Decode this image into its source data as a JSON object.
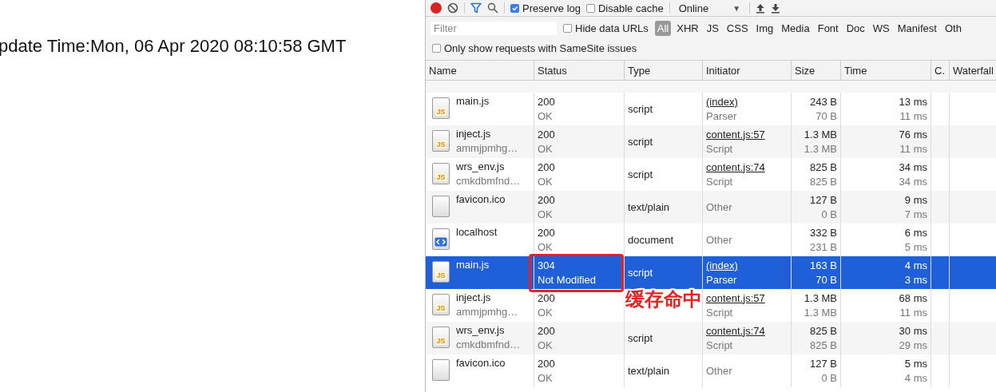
{
  "page": {
    "text": "pdate Time:Mon, 06 Apr 2020 08:10:58 GMT"
  },
  "devtools": {
    "toolbar": {
      "recording": true,
      "preserve_log": {
        "label": "Preserve log",
        "checked": true
      },
      "disable_cache": {
        "label": "Disable cache",
        "checked": false
      },
      "throttling": {
        "value": "Online",
        "caret": "▼"
      }
    },
    "filter": {
      "placeholder": "Filter",
      "hide_data_urls": {
        "label": "Hide data URLs",
        "checked": false
      },
      "types": [
        {
          "label": "All",
          "selected": true
        },
        {
          "label": "XHR",
          "selected": false
        },
        {
          "label": "JS",
          "selected": false
        },
        {
          "label": "CSS",
          "selected": false
        },
        {
          "label": "Img",
          "selected": false
        },
        {
          "label": "Media",
          "selected": false
        },
        {
          "label": "Font",
          "selected": false
        },
        {
          "label": "Doc",
          "selected": false
        },
        {
          "label": "WS",
          "selected": false
        },
        {
          "label": "Manifest",
          "selected": false
        },
        {
          "label": "Oth",
          "selected": false
        }
      ]
    },
    "samesite": {
      "label": "Only show requests with SameSite issues",
      "checked": false
    },
    "table": {
      "columns": [
        "Name",
        "Status",
        "Type",
        "Initiator",
        "Size",
        "Time",
        "C.",
        "Waterfall"
      ],
      "rows": [
        {
          "kind": "js",
          "icon_text": "JS",
          "name": "main.js",
          "status": "200",
          "status_text": "OK",
          "type": "script",
          "initiator": "(index)",
          "initiator_link": true,
          "cause": "Parser",
          "size": "243 B",
          "resource_size": "70 B",
          "time": "13 ms",
          "latency": "11 ms",
          "selected": false
        },
        {
          "kind": "js",
          "icon_text": "JS",
          "name": "inject.js",
          "detail": "ammjpmhg…",
          "status": "200",
          "status_text": "OK",
          "type": "script",
          "initiator": "content.js:57",
          "initiator_link": true,
          "cause": "Script",
          "size": "1.3 MB",
          "resource_size": "1.3 MB",
          "time": "76 ms",
          "latency": "11 ms",
          "selected": false
        },
        {
          "kind": "js",
          "icon_text": "JS",
          "name": "wrs_env.js",
          "detail": "cmkdbmfnd…",
          "status": "200",
          "status_text": "OK",
          "type": "script",
          "initiator": "content.js:74",
          "initiator_link": true,
          "cause": "Script",
          "size": "825 B",
          "resource_size": "825 B",
          "time": "34 ms",
          "latency": "34 ms",
          "selected": false
        },
        {
          "kind": "blank",
          "name": "favicon.ico",
          "status": "200",
          "status_text": "OK",
          "type": "text/plain",
          "initiator": "Other",
          "initiator_link": false,
          "size": "127 B",
          "resource_size": "0 B",
          "time": "9 ms",
          "latency": "7 ms",
          "selected": false
        },
        {
          "kind": "document",
          "name": "localhost",
          "status": "200",
          "status_text": "OK",
          "type": "document",
          "initiator": "Other",
          "initiator_link": false,
          "size": "332 B",
          "resource_size": "231 B",
          "time": "6 ms",
          "latency": "5 ms",
          "selected": false
        },
        {
          "kind": "js",
          "icon_text": "JS",
          "name": "main.js",
          "status": "304",
          "status_text": "Not Modified",
          "type": "script",
          "initiator": "(index)",
          "initiator_link": true,
          "cause": "Parser",
          "size": "163 B",
          "resource_size": "70 B",
          "time": "4 ms",
          "latency": "3 ms",
          "selected": true
        },
        {
          "kind": "js",
          "icon_text": "JS",
          "name": "inject.js",
          "detail": "ammjpmhg…",
          "status": "200",
          "status_text": "OK",
          "initiator": "content.js:57",
          "initiator_link": true,
          "cause": "Script",
          "size": "1.3 MB",
          "resource_size": "1.3 MB",
          "time": "68 ms",
          "latency": "11 ms",
          "selected": false
        },
        {
          "kind": "js",
          "icon_text": "JS",
          "name": "wrs_env.js",
          "detail": "cmkdbmfnd…",
          "status": "200",
          "status_text": "OK",
          "type": "script",
          "initiator": "content.js:74",
          "initiator_link": true,
          "cause": "Script",
          "size": "825 B",
          "resource_size": "825 B",
          "time": "30 ms",
          "latency": "29 ms",
          "selected": false
        },
        {
          "kind": "blank",
          "name": "favicon.ico",
          "status": "200",
          "status_text": "OK",
          "type": "text/plain",
          "initiator": "Other",
          "initiator_link": false,
          "size": "127 B",
          "resource_size": "0 B",
          "time": "5 ms",
          "latency": "4 ms",
          "selected": false
        }
      ]
    }
  },
  "annotation": {
    "label": "缓存命中"
  }
}
